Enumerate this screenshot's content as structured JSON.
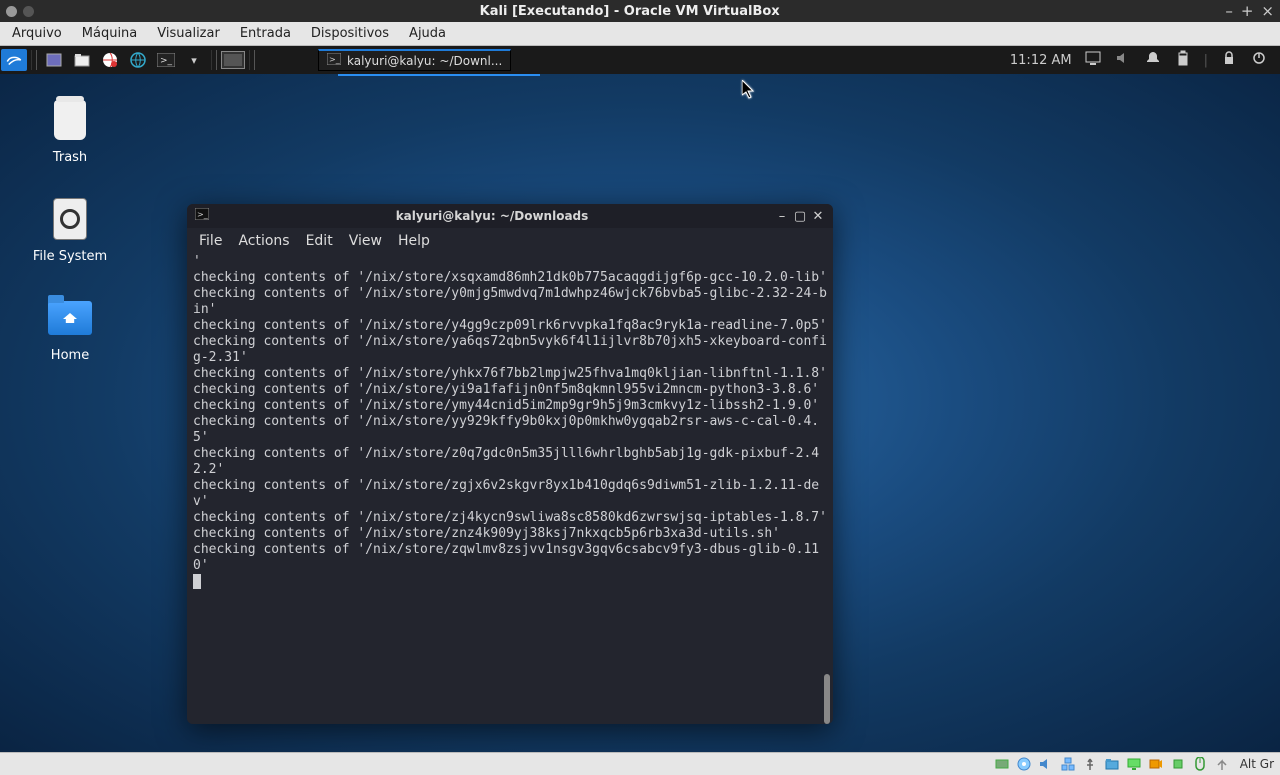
{
  "vbox": {
    "title": "Kali [Executando] - Oracle VM VirtualBox",
    "menu": [
      "Arquivo",
      "Máquina",
      "Visualizar",
      "Entrada",
      "Dispositivos",
      "Ajuda"
    ],
    "host_key": "Alt Gr"
  },
  "guest_topbar": {
    "task_label": "kalyuri@kalyu: ~/Downl...",
    "clock": "11:12 AM"
  },
  "desktop": {
    "trash_label": "Trash",
    "fs_label": "File System",
    "home_label": "Home"
  },
  "terminal": {
    "title": "kalyuri@kalyu: ~/Downloads",
    "menu": [
      "File",
      "Actions",
      "Edit",
      "View",
      "Help"
    ],
    "output_lines": [
      "'",
      "checking contents of '/nix/store/xsqxamd86mh21dk0b775acaqgdijgf6p-gcc-10.2.0-lib'",
      "checking contents of '/nix/store/y0mjg5mwdvq7m1dwhpz46wjck76bvba5-glibc-2.32-24-bin'",
      "checking contents of '/nix/store/y4gg9czp09lrk6rvvpka1fq8ac9ryk1a-readline-7.0p5'",
      "checking contents of '/nix/store/ya6qs72qbn5vyk6f4l1ijlvr8b70jxh5-xkeyboard-config-2.31'",
      "checking contents of '/nix/store/yhkx76f7bb2lmpjw25fhva1mq0kljian-libnftnl-1.1.8'",
      "checking contents of '/nix/store/yi9a1fafijn0nf5m8qkmnl955vi2mncm-python3-3.8.6'",
      "checking contents of '/nix/store/ymy44cnid5im2mp9gr9h5j9m3cmkvy1z-libssh2-1.9.0'",
      "checking contents of '/nix/store/yy929kffy9b0kxj0p0mkhw0ygqab2rsr-aws-c-cal-0.4.5'",
      "checking contents of '/nix/store/z0q7gdc0n5m35jlll6whrlbghb5abj1g-gdk-pixbuf-2.42.2'",
      "checking contents of '/nix/store/zgjx6v2skgvr8yx1b410gdq6s9diwm51-zlib-1.2.11-dev'",
      "checking contents of '/nix/store/zj4kycn9swliwa8sc8580kd6zwrswjsq-iptables-1.8.7'",
      "checking contents of '/nix/store/znz4k909yj38ksj7nkxqcb5p6rb3xa3d-utils.sh'",
      "checking contents of '/nix/store/zqwlmv8zsjvv1nsgv3gqv6csabcv9fy3-dbus-glib-0.110'"
    ]
  }
}
